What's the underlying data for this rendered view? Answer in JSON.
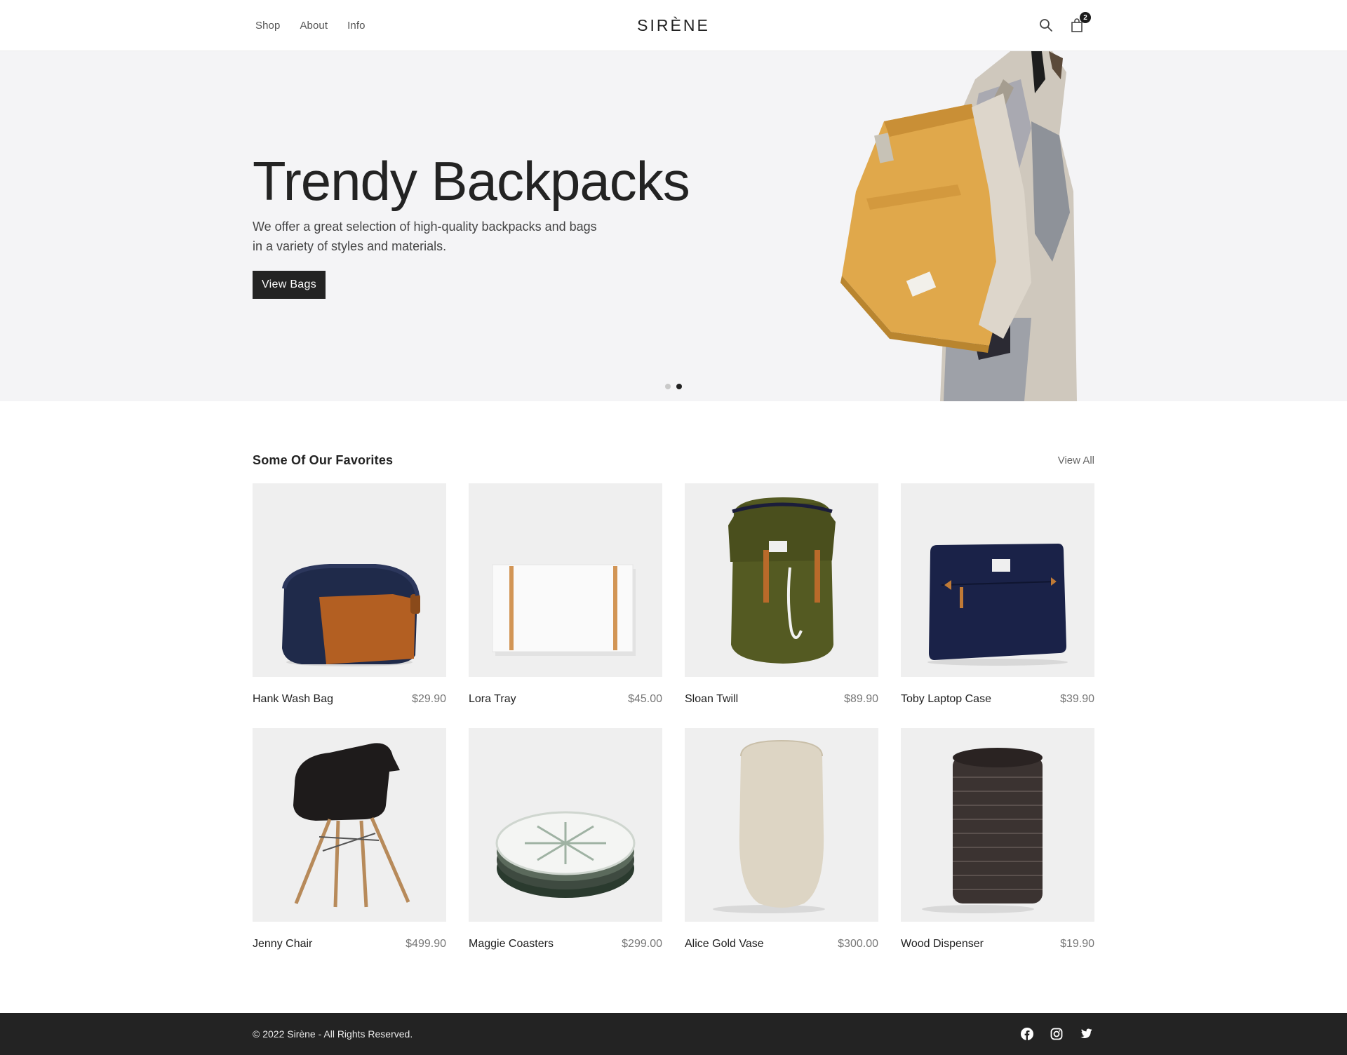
{
  "header": {
    "nav": [
      {
        "label": "Shop"
      },
      {
        "label": "About"
      },
      {
        "label": "Info"
      }
    ],
    "brand": "SIRÈNE",
    "cart_count": "2"
  },
  "hero": {
    "title": "Trendy Backpacks",
    "text": "We offer a great selection of high-quality backpacks and bags in a variety of styles and materials.",
    "button": "View Bags",
    "slides": 2,
    "active_slide": 2
  },
  "favorites": {
    "title": "Some Of Our Favorites",
    "view_all": "View All",
    "products": [
      {
        "name": "Hank Wash Bag",
        "price": "$29.90"
      },
      {
        "name": "Lora Tray",
        "price": "$45.00"
      },
      {
        "name": "Sloan Twill",
        "price": "$89.90"
      },
      {
        "name": "Toby Laptop Case",
        "price": "$39.90"
      },
      {
        "name": "Jenny Chair",
        "price": "$499.90"
      },
      {
        "name": "Maggie Coasters",
        "price": "$299.00"
      },
      {
        "name": "Alice Gold Vase",
        "price": "$300.00"
      },
      {
        "name": "Wood Dispenser",
        "price": "$19.90"
      }
    ]
  },
  "footer": {
    "copyright": "© 2022 Sirène - All Rights Reserved.",
    "social": [
      "facebook-icon",
      "instagram-icon",
      "twitter-icon"
    ]
  },
  "colors": {
    "dark": "#232323",
    "hero_bg": "#f4f4f6",
    "thumb_bg": "#efefef",
    "bag_yellow": "#e0a84b"
  }
}
